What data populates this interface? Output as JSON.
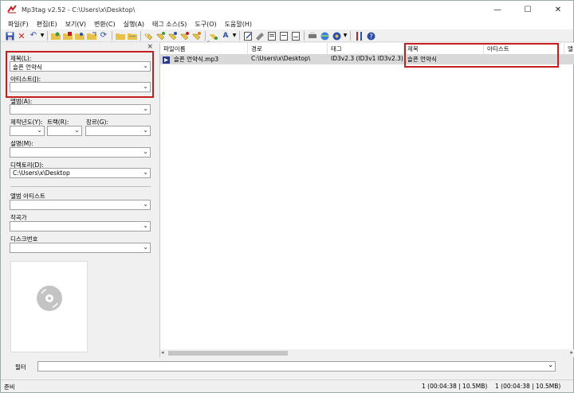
{
  "window": {
    "title": "Mp3tag v2.52  -  C:\\Users\\x\\Desktop\\",
    "minimize": "—",
    "maximize": "☐",
    "close": "✕"
  },
  "menu": [
    "파일(F)",
    "편집(E)",
    "보기(V)",
    "변환(C)",
    "실행(A)",
    "태그 소스(S)",
    "도구(O)",
    "도움말(H)"
  ],
  "tag_panel": {
    "close": "×",
    "title_label": "제목(L):",
    "title_value": "슬픈 언약식",
    "artist_label": "아티스트(J):",
    "artist_value": "",
    "album_label": "앨범(A):",
    "album_value": "",
    "year_label": "제작년도(Y):",
    "track_label": "트랙(R):",
    "genre_label": "장르(G):",
    "comment_label": "설명(M):",
    "directory_label": "디렉토리(D):",
    "directory_value": "C:\\Users\\x\\Desktop",
    "album_artist_label": "앨범 아티스트",
    "composer_label": "작곡가",
    "disc_label": "디스크번호"
  },
  "file_list": {
    "columns": [
      "파일이름",
      "경로",
      "태그",
      "제목",
      "아티스트",
      "앨"
    ],
    "rows": [
      {
        "filename": "슬픈 언약식.mp3",
        "path": "C:\\Users\\x\\Desktop\\",
        "tag": "ID3v2.3 (ID3v1 ID3v2.3)",
        "title": "슬픈 언약식",
        "artist": ""
      }
    ]
  },
  "filter": {
    "label": "필터",
    "value": ""
  },
  "status": {
    "left": "준비",
    "selected": "1 (00:04:38 | 10.5MB)",
    "total": "1 (00:04:38 | 10.5MB)"
  },
  "colors": {
    "highlight_box": "#c41e1e",
    "selected_row": "#d9d9d9"
  }
}
